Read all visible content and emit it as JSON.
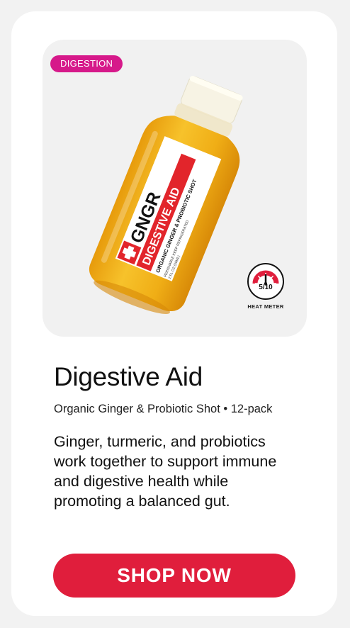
{
  "product": {
    "category_badge": "DIGESTION",
    "name": "Digestive Aid",
    "subtitle": "Organic Ginger & Probiotic Shot • 12-pack",
    "description": "Ginger, turmeric, and probiotics work together to support immune and digestive health while promoting a balanced gut.",
    "bottle_label": {
      "brand": "GNGR",
      "variant": "DIGESTIVE AID",
      "tagline": "ORGANIC GINGER & PROBIOTIC SHOT",
      "storage": "PERISHABLE KEEP REFRIGERATED",
      "volume": "2 FL OZ (59ML)"
    },
    "heat_meter": {
      "value_text": "5/10",
      "level": 0.5,
      "label": "HEAT METER"
    }
  },
  "cta": {
    "label": "SHOP NOW"
  },
  "colors": {
    "badge": "#d6198a",
    "button": "#e01e3c",
    "bottle": "#f2b21a",
    "label_red": "#e2252b"
  },
  "icons": [
    "bottle-image",
    "heat-meter-icon"
  ]
}
